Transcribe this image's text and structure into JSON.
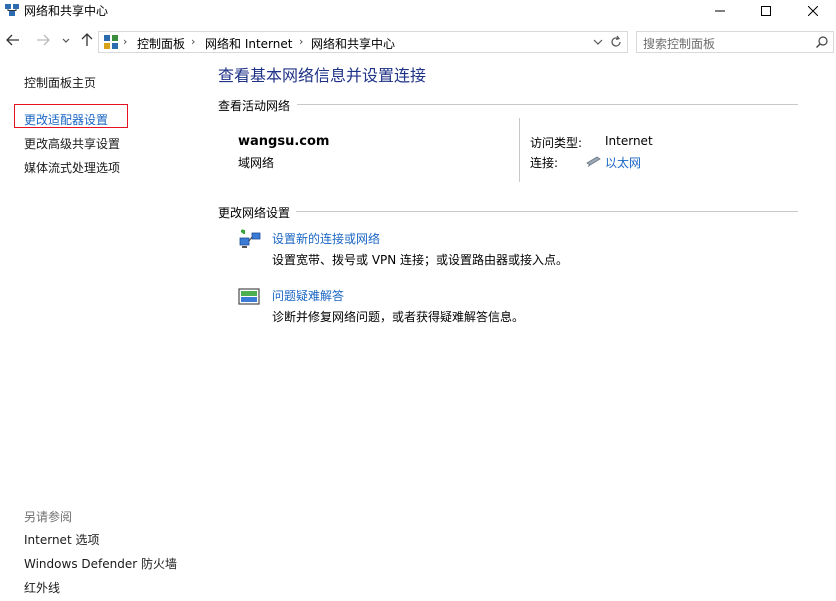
{
  "window": {
    "title": "网络和共享中心",
    "icon": "network-sharing-icon",
    "controls": {
      "minimize": "minimize-icon",
      "maximize": "maximize-icon",
      "close": "close-icon"
    }
  },
  "navigation": {
    "breadcrumbs": [
      "控制面板",
      "网络和 Internet",
      "网络和共享中心"
    ],
    "search_placeholder": "搜索控制面板"
  },
  "sidebar": {
    "items": [
      "控制面板主页",
      "更改适配器设置",
      "更改高级共享设置",
      "媒体流式处理选项"
    ],
    "highlighted_item": "更改适配器设置",
    "see_also_heading": "另请参阅",
    "see_also": [
      "Internet 选项",
      "Windows Defender 防火墙",
      "红外线"
    ]
  },
  "main": {
    "title": "查看基本网络信息并设置连接",
    "active_networks_heading": "查看活动网络",
    "network": {
      "name": "wangsu.com",
      "category": "域网络",
      "access_type_label": "访问类型:",
      "access_type_value": "Internet",
      "connections_label": "连接:",
      "connections_value": "以太网"
    },
    "change_settings_heading": "更改网络设置",
    "tasks": [
      {
        "icon": "new-connection-icon",
        "title": "设置新的连接或网络",
        "desc": "设置宽带、拨号或 VPN 连接；或设置路由器或接入点。"
      },
      {
        "icon": "troubleshoot-icon",
        "title": "问题疑难解答",
        "desc": "诊断并修复网络问题，或者获得疑难解答信息。"
      }
    ]
  },
  "colors": {
    "link": "#1a66c4",
    "title": "#1e3287",
    "highlight_border": "#e81123"
  }
}
